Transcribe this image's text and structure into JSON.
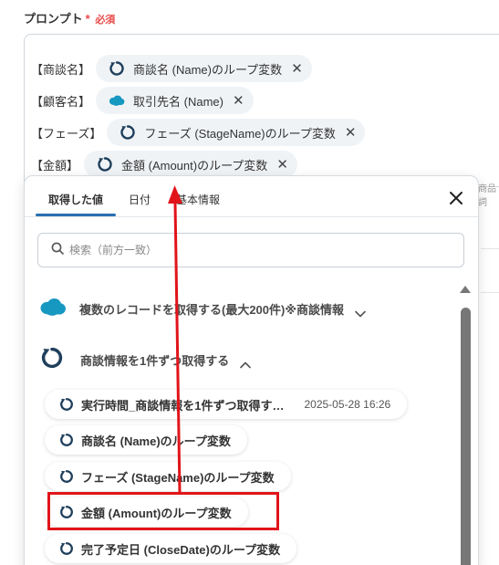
{
  "field": {
    "label": "プロンプト",
    "required_mark": "*",
    "required_text": "必須"
  },
  "prompt_rows": [
    {
      "label": "【商談名】",
      "chip": "商談名 (Name)のループ変数",
      "icon": "loop-icon"
    },
    {
      "label": "【顧客名】",
      "chip": "取引先名 (Name)",
      "icon": "salesforce-cloud-icon"
    },
    {
      "label": "【フェーズ】",
      "chip": "フェーズ (StageName)のループ変数",
      "icon": "loop-icon"
    },
    {
      "label": "【金額】",
      "chip": "金額 (Amount)のループ変数",
      "icon": "loop-icon"
    }
  ],
  "background_fragment": "商品詞",
  "popup": {
    "tabs": [
      "取得した値",
      "日付",
      "基本情報"
    ],
    "active_tab": 0,
    "search": {
      "placeholder": "検索（前方一致）"
    },
    "sections": [
      {
        "title": "複数のレコードを取得する(最大200件)※商談情報",
        "icon": "salesforce-cloud-icon",
        "state": "collapsed"
      },
      {
        "title": "商談情報を1件ずつ取得する",
        "icon": "loop-icon",
        "state": "expanded"
      }
    ],
    "items": [
      {
        "label": "実行時間_商談情報を1件ずつ取得す…",
        "meta": "2025-05-28 16:26"
      },
      {
        "label": "商談名 (Name)のループ変数",
        "meta": ""
      },
      {
        "label": "フェーズ (StageName)のループ変数",
        "meta": ""
      },
      {
        "label": "金額 (Amount)のループ変数",
        "meta": ""
      },
      {
        "label": "完了予定日 (CloseDate)のループ変数",
        "meta": ""
      }
    ]
  },
  "colors": {
    "accent": "#2a6fb0",
    "loop_icon": "#1f3f5c",
    "salesforce": "#1798c1",
    "annotation": "#e1141a",
    "required": "#e84a4a"
  }
}
